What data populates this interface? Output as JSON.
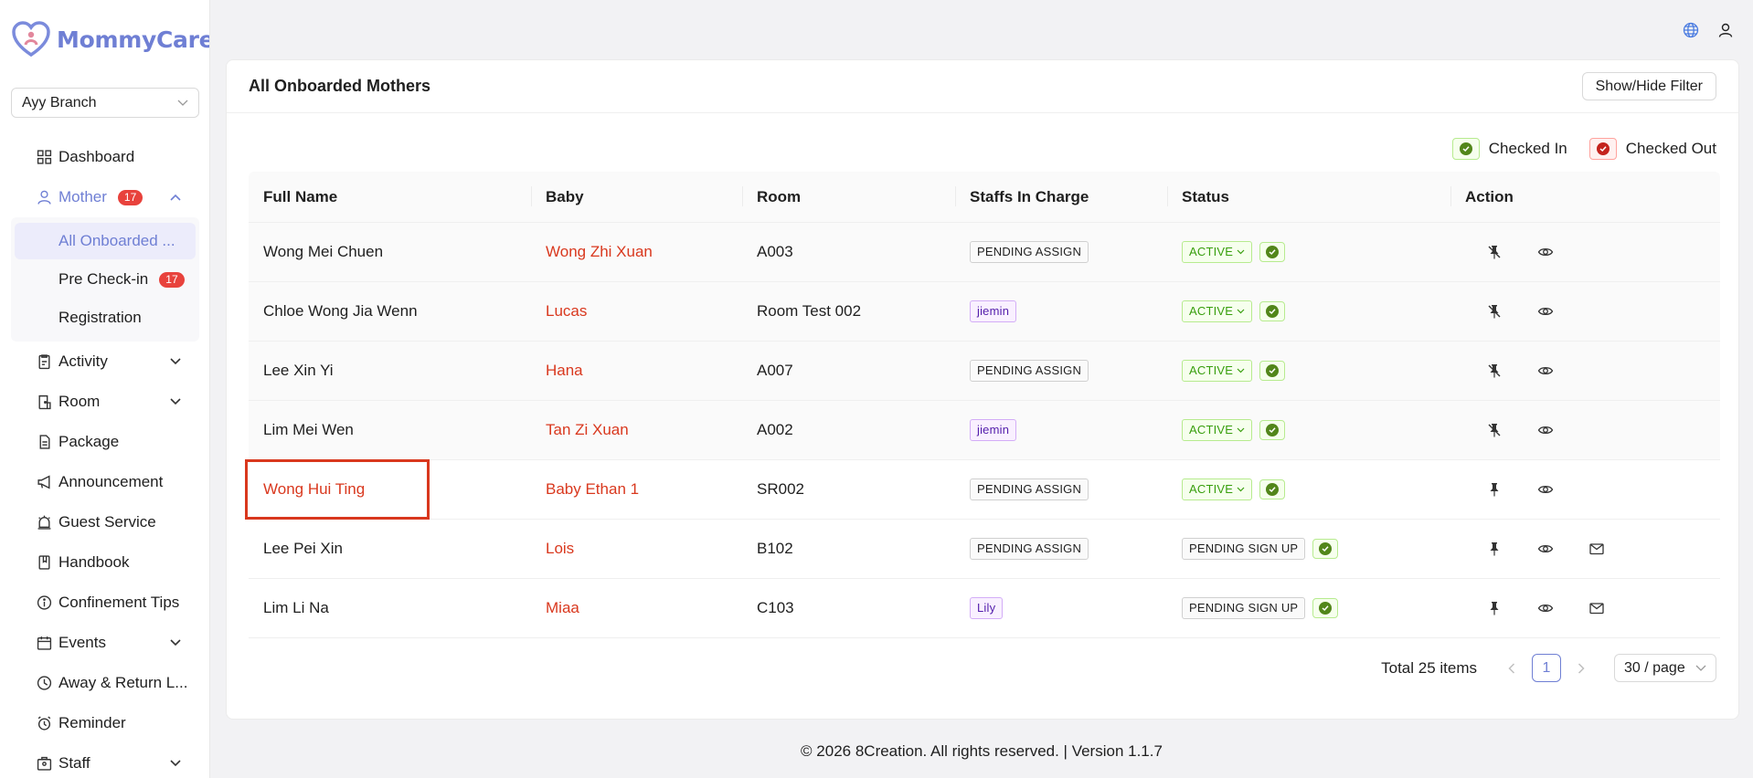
{
  "app": {
    "name": "MommyCare",
    "name_suffix": "+"
  },
  "branch": {
    "selected": "Ayy Branch"
  },
  "sidebar": {
    "items": [
      {
        "label": "Dashboard",
        "icon": "dashboard-icon"
      },
      {
        "label": "Mother",
        "icon": "user-icon",
        "badge": "17",
        "expanded": true
      },
      {
        "label": "Activity",
        "icon": "activity-icon"
      },
      {
        "label": "Room",
        "icon": "room-icon"
      },
      {
        "label": "Package",
        "icon": "package-icon"
      },
      {
        "label": "Announcement",
        "icon": "announcement-icon"
      },
      {
        "label": "Guest Service",
        "icon": "bell-icon"
      },
      {
        "label": "Handbook",
        "icon": "book-icon"
      },
      {
        "label": "Confinement Tips",
        "icon": "info-icon"
      },
      {
        "label": "Events",
        "icon": "calendar-icon"
      },
      {
        "label": "Away & Return L...",
        "icon": "clock-icon"
      },
      {
        "label": "Reminder",
        "icon": "alarm-icon"
      },
      {
        "label": "Staff",
        "icon": "staff-icon"
      }
    ],
    "mother_sub": [
      {
        "label": "All Onboarded ...",
        "selected": true
      },
      {
        "label": "Pre Check-in",
        "badge": "17"
      },
      {
        "label": "Registration"
      }
    ]
  },
  "page": {
    "title": "All Onboarded Mothers",
    "filter_button": "Show/Hide Filter",
    "legend": {
      "checked_in": "Checked In",
      "checked_out": "Checked Out"
    }
  },
  "table": {
    "headers": [
      "Full Name",
      "Baby",
      "Room",
      "Staffs In Charge",
      "Status",
      "Action"
    ],
    "rows": [
      {
        "name": "Wong Mei Chuen",
        "baby": "Wong Zhi Xuan",
        "room": "A003",
        "staff": "PENDING ASSIGN",
        "staff_type": "pending",
        "status": "ACTIVE",
        "pinned": false,
        "email": false
      },
      {
        "name": "Chloe Wong Jia Wenn",
        "baby": "Lucas",
        "room": "Room Test 002",
        "staff": "jiemin",
        "staff_type": "staff",
        "status": "ACTIVE",
        "pinned": false,
        "email": false
      },
      {
        "name": "Lee Xin Yi",
        "baby": "Hana",
        "room": "A007",
        "staff": "PENDING ASSIGN",
        "staff_type": "pending",
        "status": "ACTIVE",
        "pinned": false,
        "email": false
      },
      {
        "name": "Lim Mei Wen",
        "baby": "Tan Zi Xuan",
        "room": "A002",
        "staff": "jiemin",
        "staff_type": "staff",
        "status": "ACTIVE",
        "pinned": false,
        "email": false
      },
      {
        "name": "Wong Hui Ting",
        "baby": "Baby Ethan 1",
        "room": "SR002",
        "staff": "PENDING ASSIGN",
        "staff_type": "pending",
        "status": "ACTIVE",
        "pinned": true,
        "email": false,
        "highlighted": true
      },
      {
        "name": "Lee Pei Xin",
        "baby": "Lois",
        "room": "B102",
        "staff": "PENDING ASSIGN",
        "staff_type": "pending",
        "status": "PENDING SIGN UP",
        "pinned": true,
        "email": true
      },
      {
        "name": "Lim Li Na",
        "baby": "Miaa",
        "room": "C103",
        "staff": "Lily",
        "staff_type": "staff",
        "status": "PENDING SIGN UP",
        "pinned": true,
        "email": true
      }
    ]
  },
  "pagination": {
    "total": "Total 25 items",
    "current": "1",
    "page_size": "30 / page"
  },
  "footer": {
    "text": "© 2026 8Creation. All rights reserved. | Version 1.1.7"
  },
  "colors": {
    "brand": "#6f7fd4",
    "baby_name": "#d9381e",
    "checked_in": "#52861a",
    "checked_out": "#c4231d",
    "badge": "#e8423c"
  }
}
